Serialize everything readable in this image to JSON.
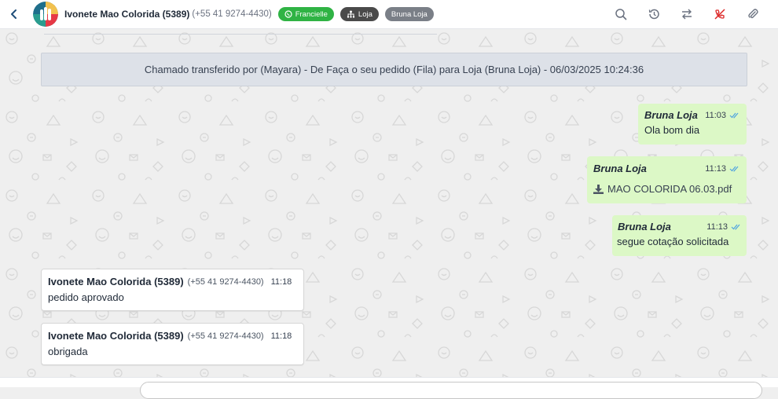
{
  "header": {
    "contact_name": "Ivonete Mao Colorida (5389)",
    "contact_phone": "(+55 41 9274-4430)",
    "tags": [
      {
        "label": "Francielle",
        "color": "#2fb344",
        "icon": "whatsapp-icon"
      },
      {
        "label": "Loja",
        "color": "#4a4a4a",
        "icon": "sitemap-icon"
      },
      {
        "label": "Bruna Loja",
        "color": "#7a7f87",
        "icon": ""
      }
    ],
    "actions": [
      "search-icon",
      "history-icon",
      "transfer-icon",
      "close-ticket-icon",
      "attachment-icon"
    ],
    "accent_red": "#dc2626"
  },
  "system_message": "Chamado transferido por (Mayara) - De Faça o seu pedido (Fila) para Loja (Bruna Loja) - 06/03/2025 10:24:36",
  "messages": [
    {
      "direction": "out",
      "sender": "Bruna Loja",
      "time": "11:03",
      "text": "Ola bom dia",
      "status": "read"
    },
    {
      "direction": "out",
      "sender": "Bruna Loja",
      "time": "11:13",
      "file": "MAO COLORIDA 06.03.pdf",
      "status": "read"
    },
    {
      "direction": "out",
      "sender": "Bruna Loja",
      "time": "11:13",
      "text": "segue cotação solicitada",
      "status": "read"
    },
    {
      "direction": "in",
      "sender": "Ivonete Mao Colorida (5389)",
      "phone": "(+55 41 9274-4430)",
      "time": "11:18",
      "text": "pedido aprovado"
    },
    {
      "direction": "in",
      "sender": "Ivonete Mao Colorida (5389)",
      "phone": "(+55 41 9274-4430)",
      "time": "11:18",
      "text": "obrigada"
    }
  ],
  "colors": {
    "outgoing_bubble": "#dcf8c6",
    "incoming_bubble": "#ffffff",
    "read_check": "#4fa3e0",
    "chat_background": "#efefef"
  }
}
